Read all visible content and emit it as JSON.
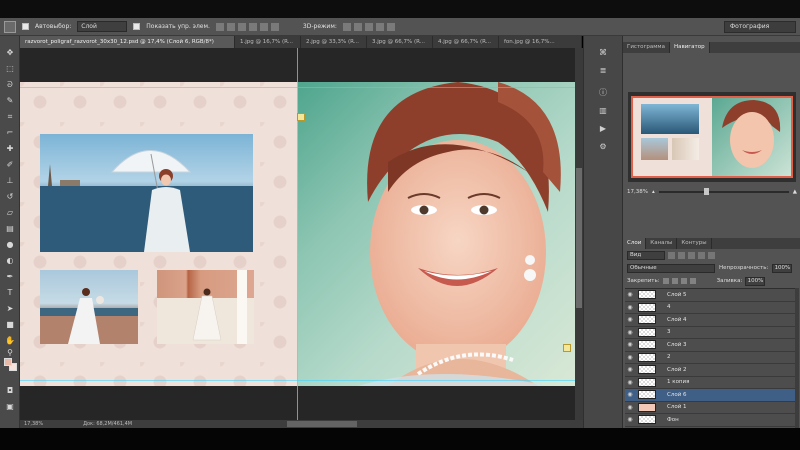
{
  "options_bar": {
    "autoselect_label": "Автовыбор:",
    "autoselect_value": "Слой",
    "show_transform_label": "Показать упр. элем.",
    "mode3d_label": "3D-режим:"
  },
  "workspace": "Фотография",
  "tabs": [
    {
      "label": "razvorot_poligraf_razvorot_30x30_12.psd @ 17,4% (Слой 6, RGB/8*)",
      "active": true
    },
    {
      "label": "1.jpg @ 16,7% (R...",
      "active": false
    },
    {
      "label": "2.jpg @ 33,3% (R...",
      "active": false
    },
    {
      "label": "3.jpg @ 66,7% (R...",
      "active": false
    },
    {
      "label": "4.jpg @ 66,7% (R...",
      "active": false
    },
    {
      "label": "fon.jpg @ 16,7%...",
      "active": false
    }
  ],
  "status": {
    "zoom": "17,38%",
    "doc": "Док: 68,2M/461,4M"
  },
  "navigator": {
    "tabs": [
      "Гистограмма",
      "Навигатор"
    ],
    "zoom": "17,38%"
  },
  "layers_panel": {
    "tabs": [
      "Слои",
      "Каналы",
      "Контуры"
    ],
    "kind_label": "Вид",
    "blend_mode": "Обычные",
    "opacity_label": "Непрозрачность:",
    "opacity_value": "100%",
    "lock_label": "Закрепить:",
    "fill_label": "Заливка:",
    "fill_value": "100%",
    "layers": [
      {
        "name": "Слой 5",
        "selected": false,
        "pink": false
      },
      {
        "name": "4",
        "selected": false,
        "pink": false
      },
      {
        "name": "Слой 4",
        "selected": false,
        "pink": false
      },
      {
        "name": "3",
        "selected": false,
        "pink": false
      },
      {
        "name": "Слой 3",
        "selected": false,
        "pink": false
      },
      {
        "name": "2",
        "selected": false,
        "pink": false
      },
      {
        "name": "Слой 2",
        "selected": false,
        "pink": false
      },
      {
        "name": "1 копия",
        "selected": false,
        "pink": false
      },
      {
        "name": "Слой 6",
        "selected": true,
        "pink": false
      },
      {
        "name": "Слой 1",
        "selected": false,
        "pink": true
      },
      {
        "name": "Фон",
        "selected": false,
        "pink": false
      }
    ]
  },
  "icons": {
    "tools": [
      "move-tool",
      "marquee-tool",
      "lasso-tool",
      "quick-select-tool",
      "crop-tool",
      "eyedropper-tool",
      "healing-brush-tool",
      "brush-tool",
      "clone-stamp-tool",
      "history-brush-tool",
      "eraser-tool",
      "gradient-tool",
      "blur-tool",
      "dodge-tool",
      "pen-tool",
      "type-tool",
      "path-select-tool",
      "shape-tool",
      "hand-tool",
      "zoom-tool"
    ]
  }
}
